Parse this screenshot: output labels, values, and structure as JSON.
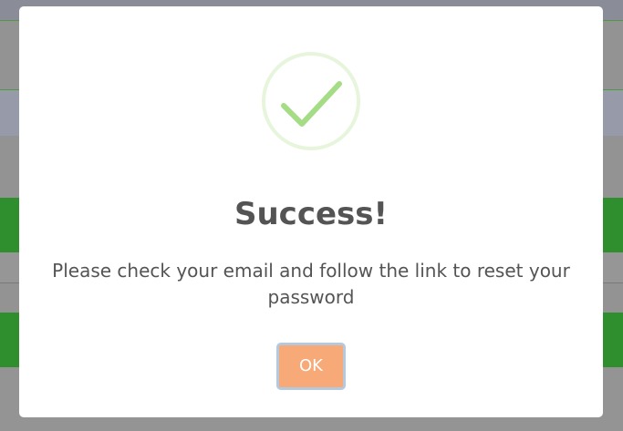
{
  "dialog": {
    "title": "Success!",
    "message": "Please check your email and follow the link to reset your password",
    "confirm_label": "OK",
    "icon": "checkmark-success-icon"
  },
  "colors": {
    "icon_stroke": "#a5dc86",
    "icon_ring": "#e8f5dd",
    "button_bg": "#f7a978",
    "button_border": "#b4c8de",
    "text": "#545454",
    "backdrop_green": "#2f8f2f"
  }
}
